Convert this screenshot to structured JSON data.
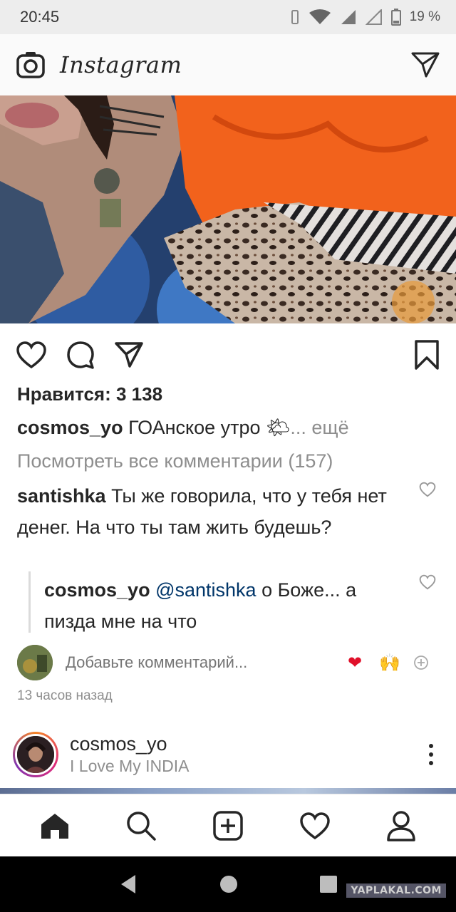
{
  "status_bar": {
    "time": "20:45",
    "battery": "19 %"
  },
  "app": {
    "logo": "Instagram"
  },
  "post": {
    "likes": "Нравится: 3 138",
    "caption": {
      "user": "cosmos_yo",
      "text": " ГОАнское утро ",
      "emoji": "🌤",
      "more": "... ещё"
    },
    "view_all_comments": "Посмотреть все комментарии (157)",
    "comments": [
      {
        "user": "santishka",
        "text": " Ты же говорила, что у тебя нет денег. На что ты там жить будешь?"
      },
      {
        "user": "cosmos_yo",
        "mention": " @santishka",
        "text": " о Боже... а пизда мне на что"
      }
    ],
    "add_comment_placeholder": "Добавьте комментарий...",
    "quick_reactions": [
      "❤",
      "🙌"
    ],
    "timestamp": "13 часов назад"
  },
  "next_post": {
    "user": "cosmos_yo",
    "location": "I Love My INDIA"
  },
  "icons": {
    "camera": "camera-icon",
    "direct": "paper-plane-icon",
    "like": "heart-icon",
    "comment": "speech-bubble-icon",
    "share": "paper-plane-icon",
    "save": "bookmark-icon",
    "home": "home-icon",
    "search": "search-icon",
    "add": "plus-square-icon",
    "activity": "heart-icon",
    "profile": "person-icon"
  },
  "colors": {
    "text": "#262626",
    "muted": "#8e8e8e",
    "mention": "#003569",
    "reaction_heart": "#e0102a"
  },
  "watermark": "YAPLAKAL.COM"
}
